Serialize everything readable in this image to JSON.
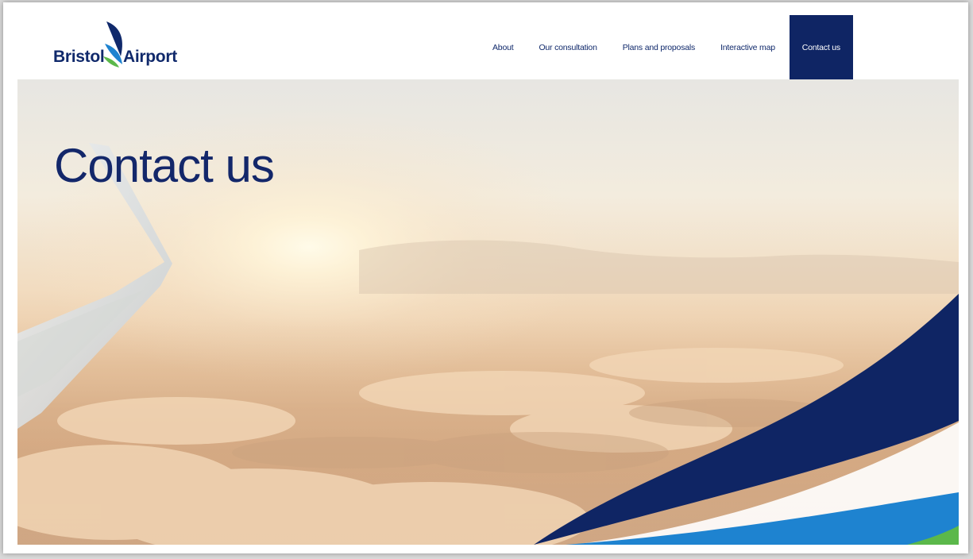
{
  "brand": {
    "name_part1": "Bristol",
    "name_part2": "Airport",
    "colors": {
      "navy": "#10296b",
      "blue": "#1e83d0",
      "green": "#5bb84a"
    }
  },
  "nav": {
    "items": [
      {
        "label": "About",
        "active": false
      },
      {
        "label": "Our consultation",
        "active": false
      },
      {
        "label": "Plans and proposals",
        "active": false
      },
      {
        "label": "Interactive map",
        "active": false
      },
      {
        "label": "Contact us",
        "active": true
      }
    ]
  },
  "hero": {
    "title": "Contact us",
    "image": "sunset-clouds-airplane-wing"
  }
}
